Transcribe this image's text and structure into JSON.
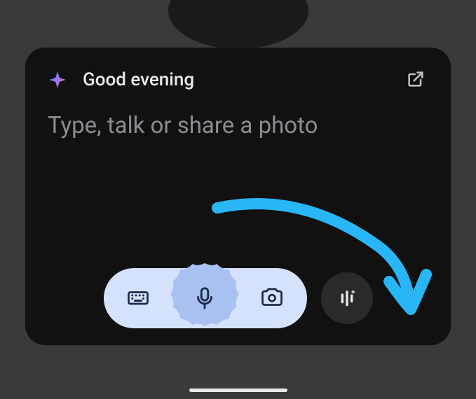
{
  "header": {
    "greeting": "Good evening"
  },
  "prompt": {
    "placeholder": "Type, talk or share a photo"
  },
  "icons": {
    "spark": "spark-icon",
    "expand": "open-in-new-icon",
    "keyboard": "keyboard-icon",
    "mic": "microphone-icon",
    "camera": "camera-icon",
    "voice": "voice-bars-icon"
  },
  "colors": {
    "card_bg": "#111111",
    "pill_bg": "#d6e2fb",
    "mic_bg": "#a9c1f0",
    "accent_arrow": "#29b6f6",
    "placeholder_text": "#8a8d91"
  }
}
